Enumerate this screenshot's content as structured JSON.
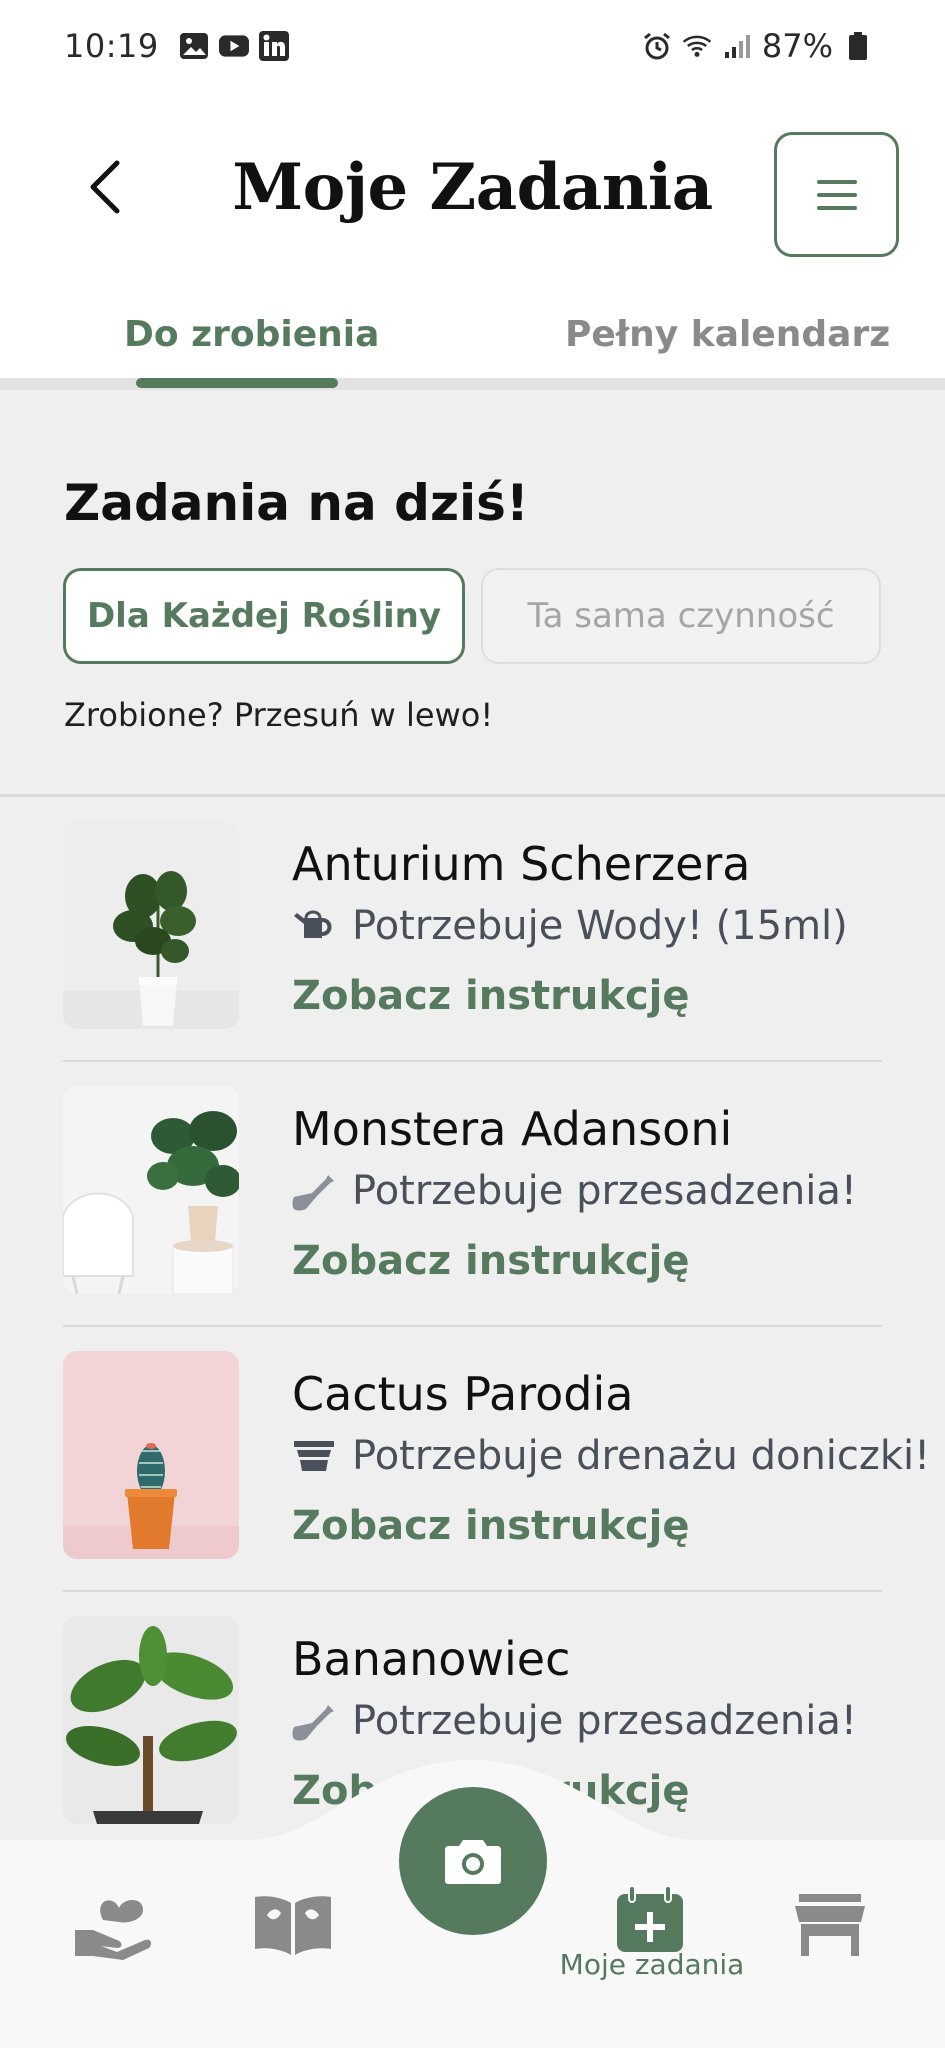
{
  "status_bar": {
    "time": "10:19",
    "battery": "87%"
  },
  "header": {
    "title": "Moje Zadania"
  },
  "tabs": [
    {
      "label": "Do zrobienia",
      "active": true
    },
    {
      "label": "Pełny kalendarz",
      "active": false
    }
  ],
  "section": {
    "title": "Zadania na dziś!",
    "filters": [
      {
        "label": "Dla Każdej Rośliny",
        "selected": true
      },
      {
        "label": "Ta sama czynność",
        "selected": false
      }
    ],
    "hint": "Zrobione? Przesuń w lewo!"
  },
  "tasks": [
    {
      "name": "Anturium Scherzera",
      "need": "Potrzebuje Wody! (15ml)",
      "need_icon": "watering-can-icon",
      "link": "Zobacz instrukcję"
    },
    {
      "name": "Monstera Adansoni",
      "need": "Potrzebuje przesadzenia!",
      "need_icon": "shovel-icon",
      "link": "Zobacz instrukcję"
    },
    {
      "name": "Cactus Parodia",
      "need": "Potrzebuje drenażu doniczki!",
      "need_icon": "pot-drainage-icon",
      "link": "Zobacz instrukcję"
    },
    {
      "name": "Bananowiec",
      "need": "Potrzebuje przesadzenia!",
      "need_icon": "shovel-icon",
      "link": "Zobacz instrukcję"
    }
  ],
  "bottom_nav": {
    "items": [
      {
        "icon": "plant-hand-icon"
      },
      {
        "icon": "book-icon"
      },
      {
        "icon": "camera-icon"
      },
      {
        "icon": "calendar-plus-icon",
        "label": "Moje zadania",
        "active": true
      },
      {
        "icon": "shop-icon"
      }
    ]
  },
  "colors": {
    "accent": "#557a5e",
    "background": "#efefef",
    "muted": "#8a8a8a"
  }
}
